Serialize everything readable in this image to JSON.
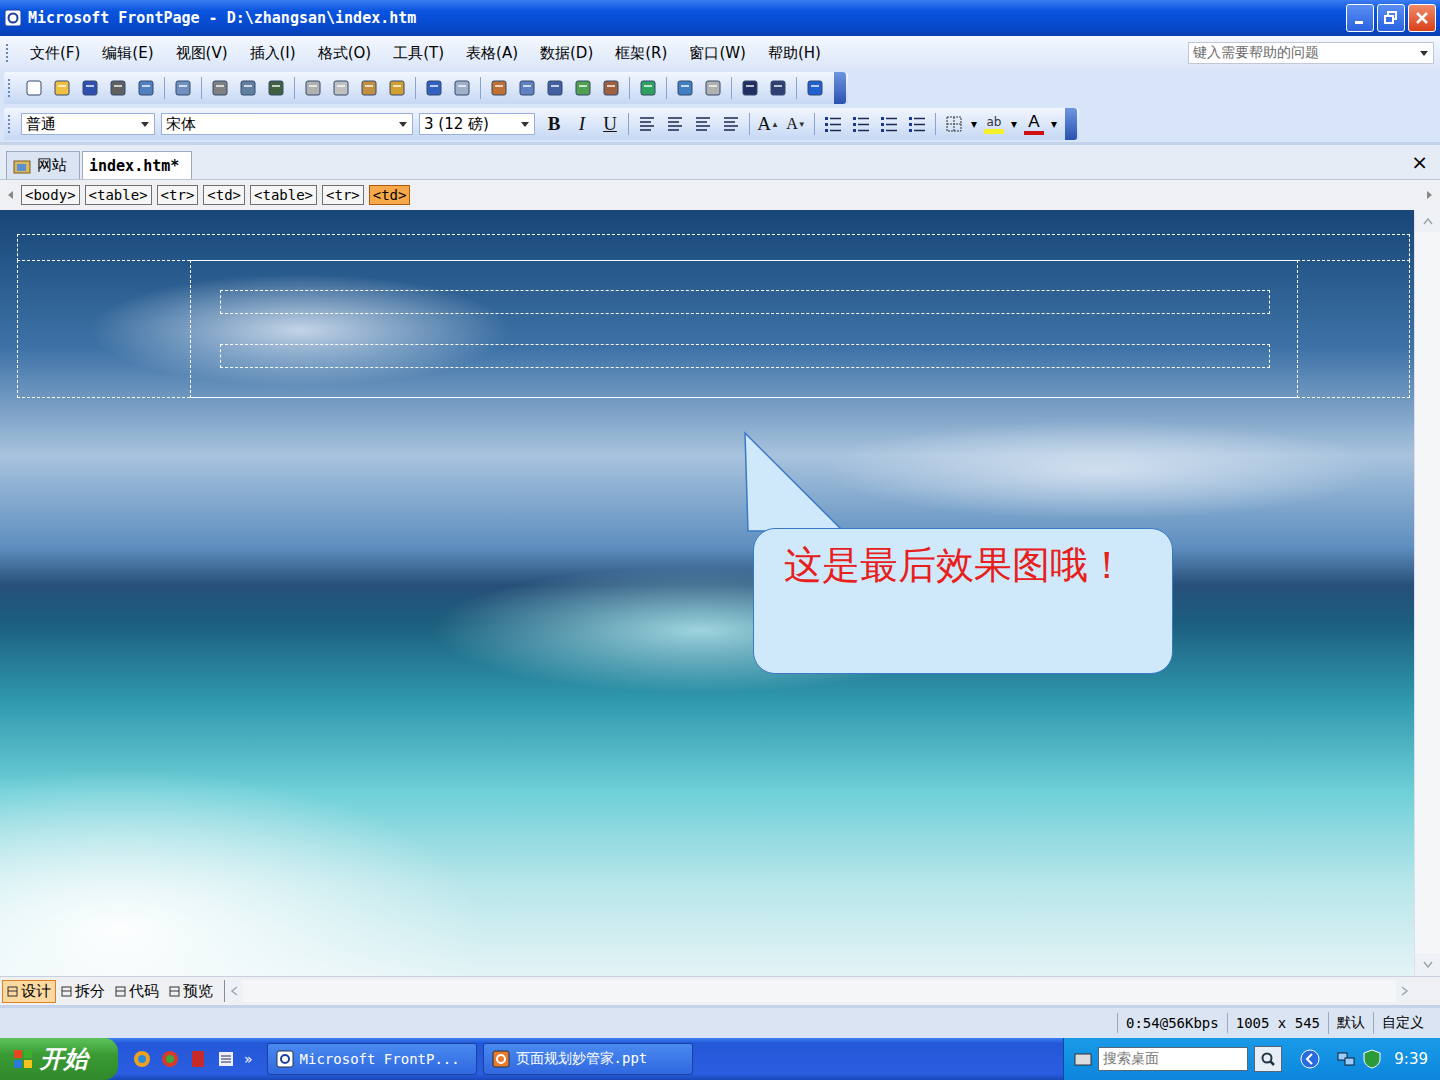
{
  "window": {
    "title": "Microsoft FrontPage - D:\\zhangsan\\index.htm"
  },
  "menu": [
    "文件(F)",
    "编辑(E)",
    "视图(V)",
    "插入(I)",
    "格式(O)",
    "工具(T)",
    "表格(A)",
    "数据(D)",
    "框架(R)",
    "窗口(W)",
    "帮助(H)"
  ],
  "help": {
    "placeholder": "键入需要帮助的问题"
  },
  "format_bar": {
    "style": "普通",
    "font": "宋体",
    "size": "3 (12 磅)",
    "buttons": [
      "B",
      "I",
      "U"
    ],
    "grow": "A",
    "shrink": "A",
    "highlight": "ab",
    "font_color": "A"
  },
  "doc_tabs": [
    {
      "label": "网站",
      "selected": false
    },
    {
      "label": "index.htm*",
      "selected": true
    }
  ],
  "close_doc": "×",
  "tag_path": [
    {
      "label": "<body>",
      "selected": false
    },
    {
      "label": "<table>",
      "selected": false
    },
    {
      "label": "<tr>",
      "selected": false
    },
    {
      "label": "<td>",
      "selected": false
    },
    {
      "label": "<table>",
      "selected": false
    },
    {
      "label": "<tr>",
      "selected": false
    },
    {
      "label": "<td>",
      "selected": true
    }
  ],
  "callout": {
    "text": "这是最后效果图哦！"
  },
  "view_tabs": [
    {
      "label": "设计",
      "selected": true
    },
    {
      "label": "拆分",
      "selected": false
    },
    {
      "label": "代码",
      "selected": false
    },
    {
      "label": "预览",
      "selected": false
    }
  ],
  "status_bar": [
    "0:54@56Kbps",
    "1005 x 545",
    "默认",
    "自定义"
  ],
  "taskbar": {
    "start": "开始",
    "more": "»",
    "tasks": [
      "Microsoft FrontP...",
      "页面规划妙管家.ppt"
    ],
    "search": "搜索桌面",
    "time": "9:39"
  }
}
